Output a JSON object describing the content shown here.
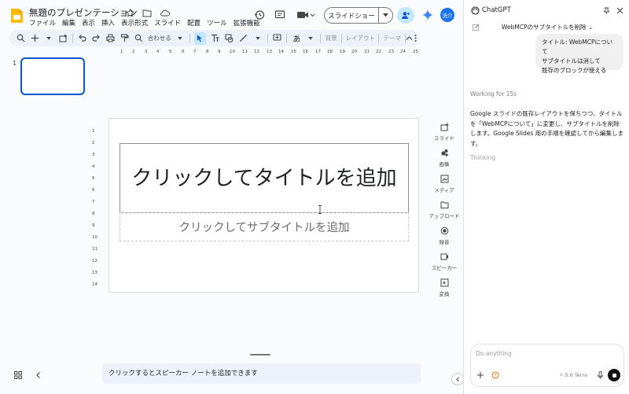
{
  "slides_app": {
    "doc_title": "無題のプレゼンテーション",
    "menu": [
      "ファイル",
      "編集",
      "表示",
      "挿入",
      "表示形式",
      "スライド",
      "配置",
      "ツール",
      "拡張機能"
    ],
    "slideshow_label": "スライドショー",
    "avatar_label": "洸介",
    "toolbar": {
      "zoom_label": "合わせる",
      "text_style_label": "あ",
      "background_label": "背景",
      "layout_label": "レイアウト",
      "theme_label": "テーマ"
    },
    "slide_number": "1",
    "ruler_h": [
      "1",
      "2",
      "3",
      "4",
      "5",
      "6",
      "7",
      "8",
      "9",
      "10",
      "11",
      "12",
      "13",
      "14",
      "15",
      "16",
      "17",
      "18",
      "19",
      "20",
      "21",
      "22",
      "23",
      "24",
      "25"
    ],
    "ruler_v": [
      "1",
      "2",
      "3",
      "4",
      "5",
      "6",
      "7",
      "8",
      "9",
      "10",
      "11",
      "12",
      "13",
      "14"
    ],
    "slide": {
      "title_placeholder": "クリックしてタイトルを追加",
      "subtitle_placeholder": "クリックしてサブタイトルを追加"
    },
    "side_panel": [
      {
        "label": "スライド",
        "icon": "add-slide-icon"
      },
      {
        "label": "画像",
        "icon": "image-icon"
      },
      {
        "label": "メディア",
        "icon": "media-icon"
      },
      {
        "label": "アップロード",
        "icon": "folder-icon"
      },
      {
        "label": "録音",
        "icon": "record-icon"
      },
      {
        "label": "スピーカー",
        "icon": "speaker-icon"
      },
      {
        "label": "変換",
        "icon": "convert-icon"
      }
    ],
    "notes_placeholder": "クリックするとスピーカー ノートを追加できます"
  },
  "chat": {
    "app_title": "ChatGPT",
    "conversation_title": "WebMCPのサブタイトルを削除 ⌄",
    "user_message_lines": [
      "タイトル: WebMCPについて",
      "サブタイトルは消して",
      "既存のブロックが使える"
    ],
    "working_status": "Working for 15s",
    "assistant_message": "Google スライドの既存レイアウトを保ちつつ、タイトルを「WebMCPについて」に変更し、サブタイトルを削除します。Google Slides 用の手順を確認してから編集します。",
    "thinking_label": "Thinking",
    "input_placeholder": "Do anything",
    "model_label": "5.6 Terra"
  },
  "colors": {
    "accent_blue": "#0b57d0",
    "toolbar_bg": "#edf2fa",
    "share_bg": "#c2e7ff",
    "avatar_bg": "#1a73e8"
  }
}
